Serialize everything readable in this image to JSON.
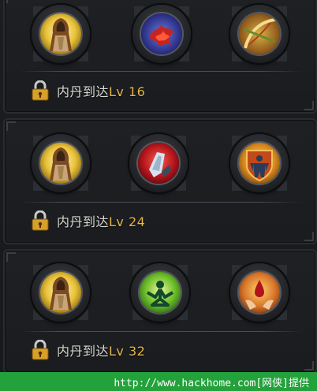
{
  "rows": [
    {
      "skills": [
        {
          "icon": "hooded-monk-icon"
        },
        {
          "icon": "red-phoenix-icon"
        },
        {
          "icon": "golden-bow-icon"
        }
      ],
      "requirement": {
        "prefix": "内丹到达",
        "level": "Lv 16",
        "icon": "lock-icon"
      }
    },
    {
      "skills": [
        {
          "icon": "hooded-monk-icon"
        },
        {
          "icon": "red-gauntlet-icon"
        },
        {
          "icon": "shield-warrior-icon"
        }
      ],
      "requirement": {
        "prefix": "内丹到达",
        "level": "Lv 24",
        "icon": "lock-icon"
      }
    },
    {
      "skills": [
        {
          "icon": "hooded-monk-icon"
        },
        {
          "icon": "green-meditation-icon"
        },
        {
          "icon": "blood-drop-hands-icon"
        }
      ],
      "requirement": {
        "prefix": "内丹到达",
        "level": "Lv 32",
        "icon": "lock-icon"
      }
    }
  ],
  "footer": {
    "text": "http://www.hackhome.com[网侠]提供"
  },
  "colors": {
    "level": "#e8b84a",
    "footer_bg": "#23a13a",
    "panel_bg": "#1e2023"
  }
}
